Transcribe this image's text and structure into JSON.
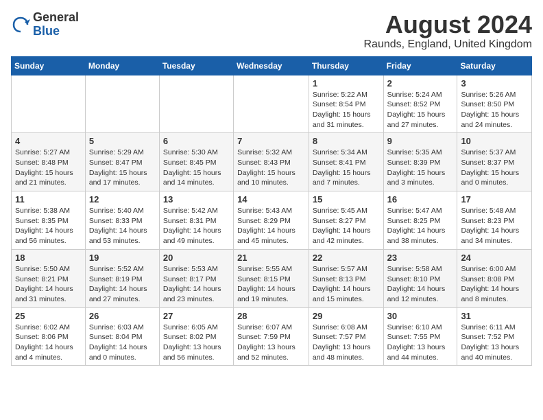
{
  "header": {
    "logo_general": "General",
    "logo_blue": "Blue",
    "month_year": "August 2024",
    "location": "Raunds, England, United Kingdom"
  },
  "days_of_week": [
    "Sunday",
    "Monday",
    "Tuesday",
    "Wednesday",
    "Thursday",
    "Friday",
    "Saturday"
  ],
  "weeks": [
    [
      {
        "day": "",
        "content": ""
      },
      {
        "day": "",
        "content": ""
      },
      {
        "day": "",
        "content": ""
      },
      {
        "day": "",
        "content": ""
      },
      {
        "day": "1",
        "content": "Sunrise: 5:22 AM\nSunset: 8:54 PM\nDaylight: 15 hours\nand 31 minutes."
      },
      {
        "day": "2",
        "content": "Sunrise: 5:24 AM\nSunset: 8:52 PM\nDaylight: 15 hours\nand 27 minutes."
      },
      {
        "day": "3",
        "content": "Sunrise: 5:26 AM\nSunset: 8:50 PM\nDaylight: 15 hours\nand 24 minutes."
      }
    ],
    [
      {
        "day": "4",
        "content": "Sunrise: 5:27 AM\nSunset: 8:48 PM\nDaylight: 15 hours\nand 21 minutes."
      },
      {
        "day": "5",
        "content": "Sunrise: 5:29 AM\nSunset: 8:47 PM\nDaylight: 15 hours\nand 17 minutes."
      },
      {
        "day": "6",
        "content": "Sunrise: 5:30 AM\nSunset: 8:45 PM\nDaylight: 15 hours\nand 14 minutes."
      },
      {
        "day": "7",
        "content": "Sunrise: 5:32 AM\nSunset: 8:43 PM\nDaylight: 15 hours\nand 10 minutes."
      },
      {
        "day": "8",
        "content": "Sunrise: 5:34 AM\nSunset: 8:41 PM\nDaylight: 15 hours\nand 7 minutes."
      },
      {
        "day": "9",
        "content": "Sunrise: 5:35 AM\nSunset: 8:39 PM\nDaylight: 15 hours\nand 3 minutes."
      },
      {
        "day": "10",
        "content": "Sunrise: 5:37 AM\nSunset: 8:37 PM\nDaylight: 15 hours\nand 0 minutes."
      }
    ],
    [
      {
        "day": "11",
        "content": "Sunrise: 5:38 AM\nSunset: 8:35 PM\nDaylight: 14 hours\nand 56 minutes."
      },
      {
        "day": "12",
        "content": "Sunrise: 5:40 AM\nSunset: 8:33 PM\nDaylight: 14 hours\nand 53 minutes."
      },
      {
        "day": "13",
        "content": "Sunrise: 5:42 AM\nSunset: 8:31 PM\nDaylight: 14 hours\nand 49 minutes."
      },
      {
        "day": "14",
        "content": "Sunrise: 5:43 AM\nSunset: 8:29 PM\nDaylight: 14 hours\nand 45 minutes."
      },
      {
        "day": "15",
        "content": "Sunrise: 5:45 AM\nSunset: 8:27 PM\nDaylight: 14 hours\nand 42 minutes."
      },
      {
        "day": "16",
        "content": "Sunrise: 5:47 AM\nSunset: 8:25 PM\nDaylight: 14 hours\nand 38 minutes."
      },
      {
        "day": "17",
        "content": "Sunrise: 5:48 AM\nSunset: 8:23 PM\nDaylight: 14 hours\nand 34 minutes."
      }
    ],
    [
      {
        "day": "18",
        "content": "Sunrise: 5:50 AM\nSunset: 8:21 PM\nDaylight: 14 hours\nand 31 minutes."
      },
      {
        "day": "19",
        "content": "Sunrise: 5:52 AM\nSunset: 8:19 PM\nDaylight: 14 hours\nand 27 minutes."
      },
      {
        "day": "20",
        "content": "Sunrise: 5:53 AM\nSunset: 8:17 PM\nDaylight: 14 hours\nand 23 minutes."
      },
      {
        "day": "21",
        "content": "Sunrise: 5:55 AM\nSunset: 8:15 PM\nDaylight: 14 hours\nand 19 minutes."
      },
      {
        "day": "22",
        "content": "Sunrise: 5:57 AM\nSunset: 8:13 PM\nDaylight: 14 hours\nand 15 minutes."
      },
      {
        "day": "23",
        "content": "Sunrise: 5:58 AM\nSunset: 8:10 PM\nDaylight: 14 hours\nand 12 minutes."
      },
      {
        "day": "24",
        "content": "Sunrise: 6:00 AM\nSunset: 8:08 PM\nDaylight: 14 hours\nand 8 minutes."
      }
    ],
    [
      {
        "day": "25",
        "content": "Sunrise: 6:02 AM\nSunset: 8:06 PM\nDaylight: 14 hours\nand 4 minutes."
      },
      {
        "day": "26",
        "content": "Sunrise: 6:03 AM\nSunset: 8:04 PM\nDaylight: 14 hours\nand 0 minutes."
      },
      {
        "day": "27",
        "content": "Sunrise: 6:05 AM\nSunset: 8:02 PM\nDaylight: 13 hours\nand 56 minutes."
      },
      {
        "day": "28",
        "content": "Sunrise: 6:07 AM\nSunset: 7:59 PM\nDaylight: 13 hours\nand 52 minutes."
      },
      {
        "day": "29",
        "content": "Sunrise: 6:08 AM\nSunset: 7:57 PM\nDaylight: 13 hours\nand 48 minutes."
      },
      {
        "day": "30",
        "content": "Sunrise: 6:10 AM\nSunset: 7:55 PM\nDaylight: 13 hours\nand 44 minutes."
      },
      {
        "day": "31",
        "content": "Sunrise: 6:11 AM\nSunset: 7:52 PM\nDaylight: 13 hours\nand 40 minutes."
      }
    ]
  ]
}
